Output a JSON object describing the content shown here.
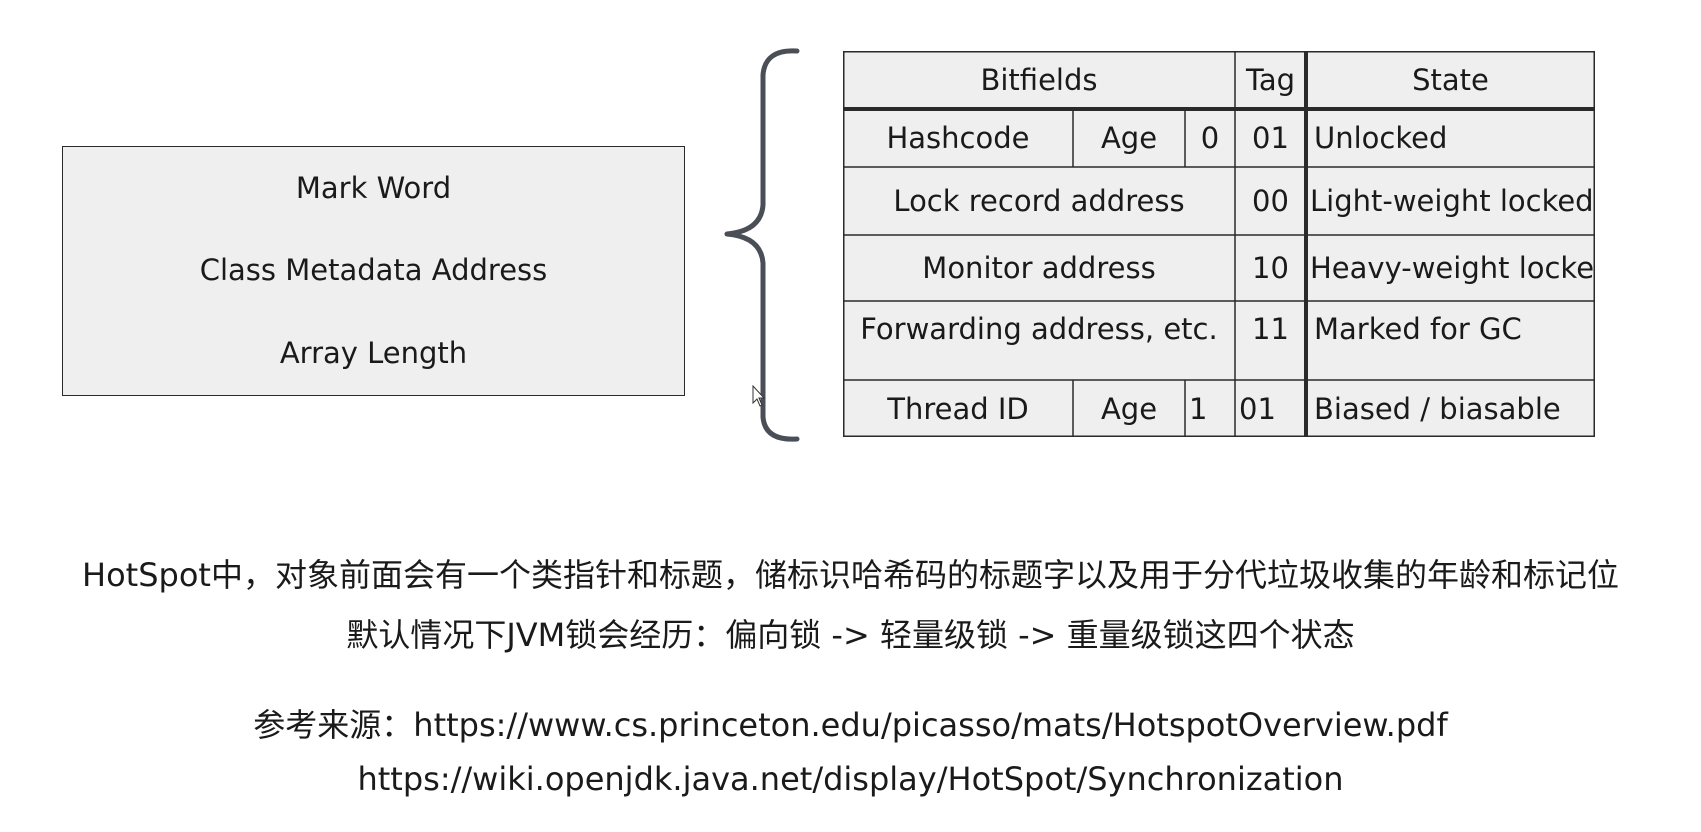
{
  "object_header": {
    "rows": [
      "Mark Word",
      "Class Metadata Address",
      "Array Length"
    ]
  },
  "mark_word_table": {
    "headers": {
      "bitfields": "Bitfields",
      "tag": "Tag",
      "state": "State"
    },
    "rows": [
      {
        "hashcode": "Hashcode",
        "age": "Age",
        "bias": "0",
        "tag": "01",
        "state": "Unlocked"
      },
      {
        "bitfields": "Lock record address",
        "tag": "00",
        "state": "Light-weight locked"
      },
      {
        "bitfields": "Monitor address",
        "tag": "10",
        "state": "Heavy-weight locked"
      },
      {
        "bitfields": "Forwarding address, etc.",
        "tag": "11",
        "state": "Marked for GC"
      },
      {
        "thread_id": "Thread ID",
        "age": "Age",
        "bias": "1",
        "tag": "01",
        "state": "Biased / biasable"
      }
    ]
  },
  "captions": {
    "line1": "HotSpot中，对象前面会有一个类指针和标题，储标识哈希码的标题字以及用于分代垃圾收集的年龄和标记位",
    "line2": "默认情况下JVM锁会经历：偏向锁 -> 轻量级锁 -> 重量级锁这四个状态",
    "line3": "参考来源：https://www.cs.princeton.edu/picasso/mats/HotspotOverview.pdf",
    "line4": "https://wiki.openjdk.java.net/display/HotSpot/Synchronization"
  }
}
